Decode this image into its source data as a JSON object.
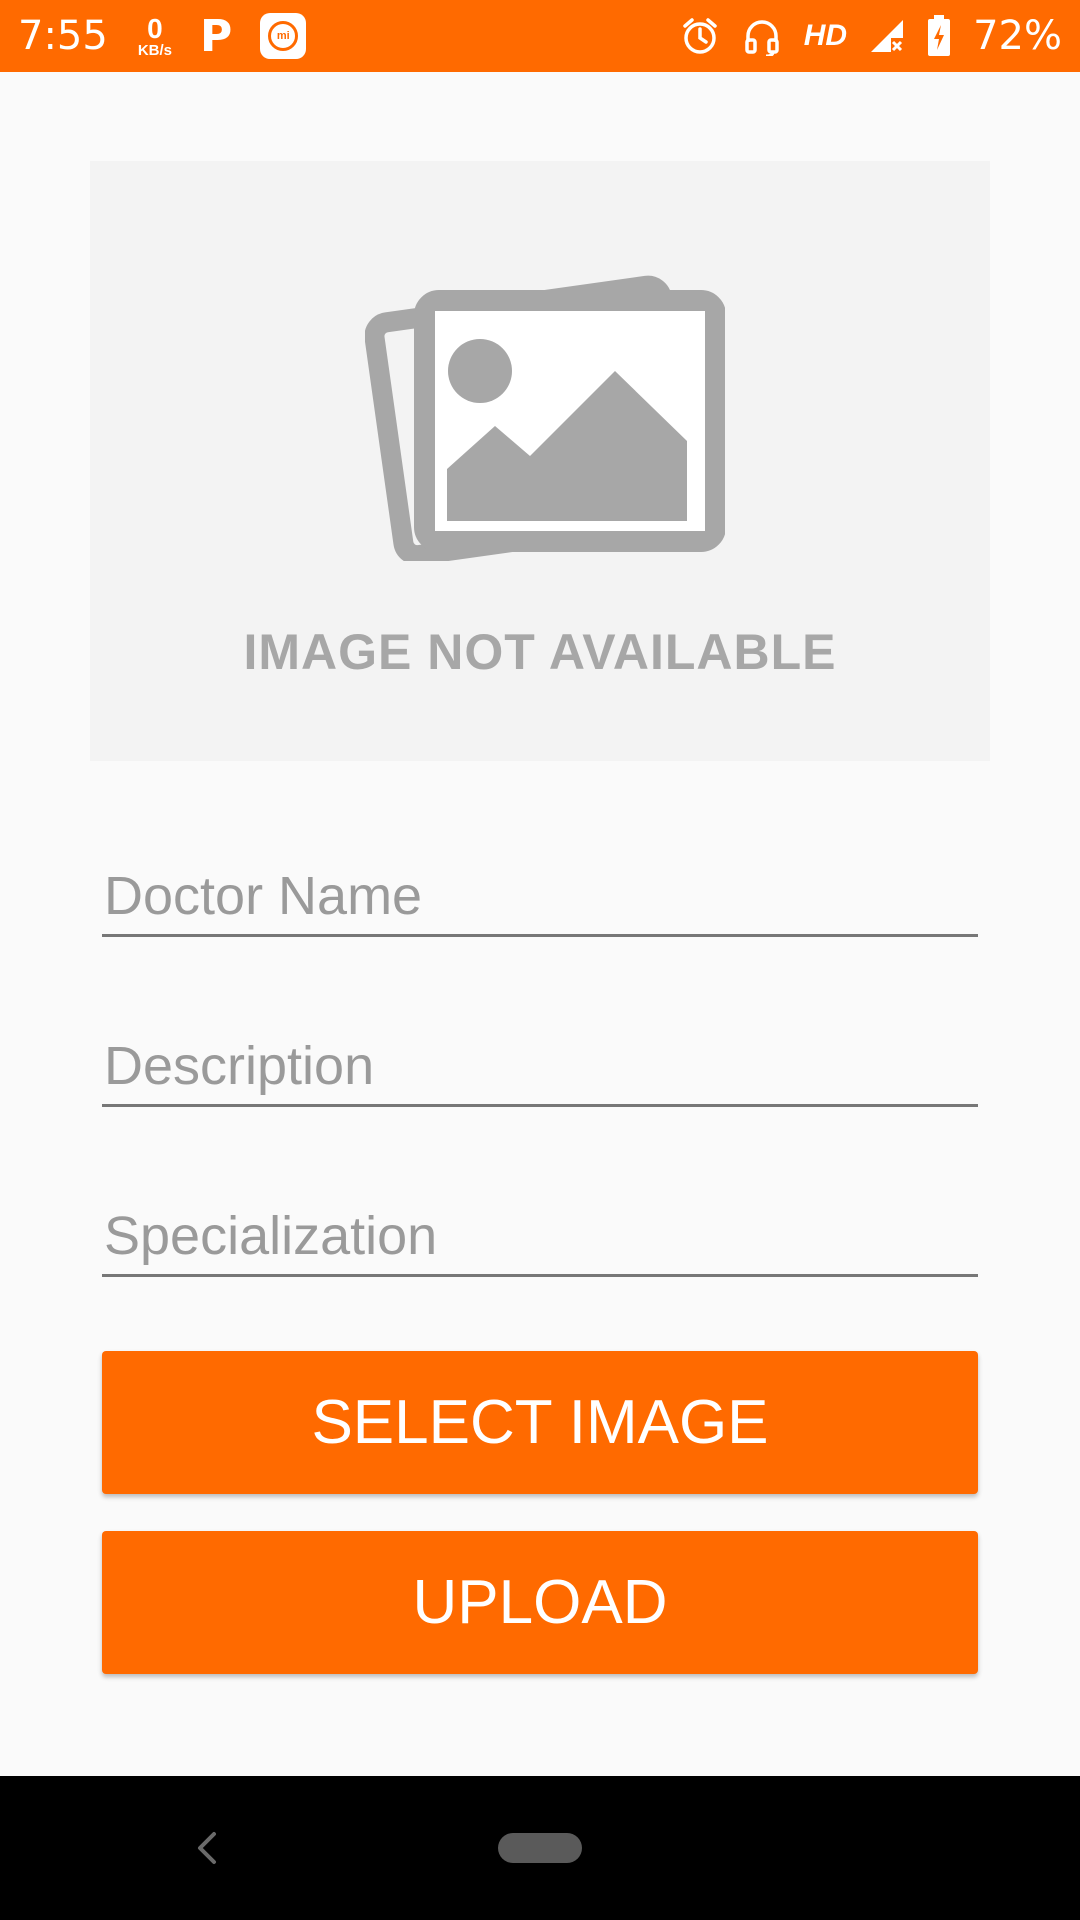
{
  "status_bar": {
    "time": "7:55",
    "net_speed_value": "0",
    "net_speed_unit": "KB/s",
    "hd_label": "HD",
    "battery_percent": "72%",
    "background_color": "#ff6a00"
  },
  "image_placeholder": {
    "text": "IMAGE NOT AVAILABLE"
  },
  "form": {
    "doctor_name_placeholder": "Doctor Name",
    "description_placeholder": "Description",
    "specialization_placeholder": "Specialization"
  },
  "buttons": {
    "select_image_label": "SELECT IMAGE",
    "upload_label": "UPLOAD",
    "color": "#ff6a00"
  },
  "icons": {
    "status_app_1": "p-icon",
    "status_app_2": "mi-icon",
    "alarm": "alarm-icon",
    "headset": "headset-icon",
    "signal": "signal-no-service-icon",
    "battery": "battery-charging-icon",
    "placeholder_picture": "image-placeholder-icon",
    "nav_back": "back-icon",
    "nav_home": "home-pill-icon"
  }
}
